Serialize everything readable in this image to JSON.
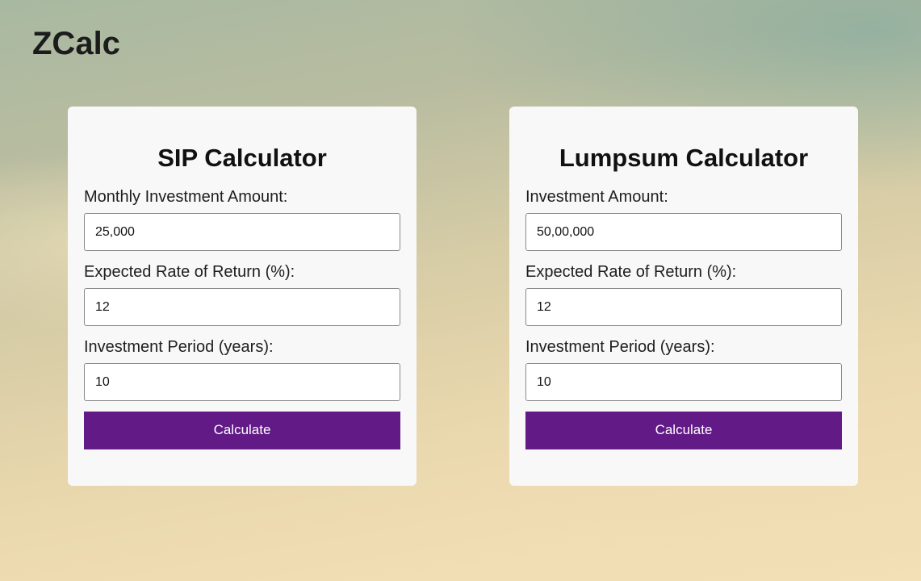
{
  "app": {
    "title": "ZCalc"
  },
  "sip": {
    "title": "SIP Calculator",
    "fields": [
      {
        "label": "Monthly Investment Amount:",
        "value": "25,000"
      },
      {
        "label": "Expected Rate of Return (%):",
        "value": "12"
      },
      {
        "label": "Investment Period (years):",
        "value": "10"
      }
    ],
    "button_label": "Calculate"
  },
  "lumpsum": {
    "title": "Lumpsum Calculator",
    "fields": [
      {
        "label": "Investment Amount:",
        "value": "50,00,000"
      },
      {
        "label": "Expected Rate of Return (%):",
        "value": "12"
      },
      {
        "label": "Investment Period (years):",
        "value": "10"
      }
    ],
    "button_label": "Calculate"
  },
  "colors": {
    "button": "#621a87",
    "card": "#f8f8f8"
  }
}
